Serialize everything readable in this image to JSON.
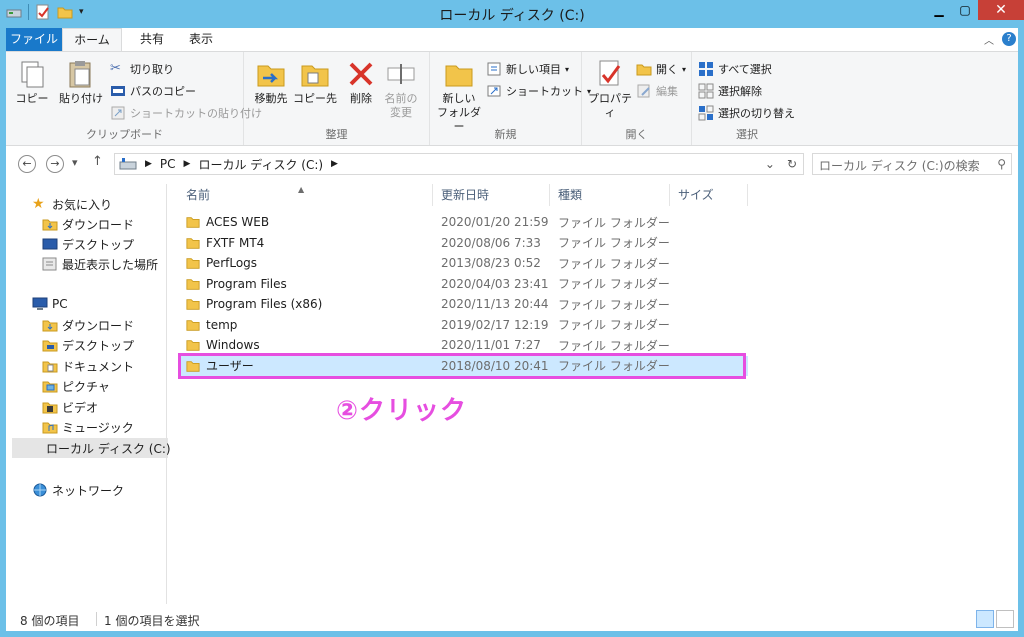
{
  "window": {
    "title": "ローカル ディスク (C:)"
  },
  "ribbon_tabs": {
    "file": "ファイル",
    "home": "ホーム",
    "share": "共有",
    "view": "表示"
  },
  "ribbon": {
    "clipboard": {
      "label": "クリップボード",
      "copy": "コピー",
      "paste": "貼り付け",
      "cut": "切り取り",
      "copy_path": "パスのコピー",
      "paste_shortcut": "ショートカットの貼り付け"
    },
    "organize": {
      "label": "整理",
      "move_to": "移動先",
      "copy_to": "コピー先",
      "delete": "削除",
      "rename_1": "名前の",
      "rename_2": "変更"
    },
    "new": {
      "label": "新規",
      "new_folder_1": "新しい",
      "new_folder_2": "フォルダー",
      "new_item": "新しい項目",
      "easy_access": "ショートカット"
    },
    "open": {
      "label": "開く",
      "properties": "プロパティ",
      "open": "開く",
      "edit": "編集"
    },
    "select": {
      "label": "選択",
      "select_all": "すべて選択",
      "select_none": "選択解除",
      "invert": "選択の切り替え"
    }
  },
  "address": {
    "crumbs": [
      "PC",
      "ローカル ディスク (C:)"
    ],
    "search_placeholder": "ローカル ディスク (C:)の検索"
  },
  "nav": {
    "favorites": "お気に入り",
    "fav_items": [
      "ダウンロード",
      "デスクトップ",
      "最近表示した場所"
    ],
    "pc": "PC",
    "pc_items": [
      "ダウンロード",
      "デスクトップ",
      "ドキュメント",
      "ピクチャ",
      "ビデオ",
      "ミュージック",
      "ローカル ディスク (C:)"
    ],
    "network": "ネットワーク"
  },
  "columns": {
    "name": "名前",
    "modified": "更新日時",
    "type": "種類",
    "size": "サイズ"
  },
  "files": [
    {
      "name": "ACES WEB",
      "modified": "2020/01/20 21:59",
      "type": "ファイル フォルダー"
    },
    {
      "name": "FXTF MT4",
      "modified": "2020/08/06 7:33",
      "type": "ファイル フォルダー"
    },
    {
      "name": "PerfLogs",
      "modified": "2013/08/23 0:52",
      "type": "ファイル フォルダー"
    },
    {
      "name": "Program Files",
      "modified": "2020/04/03 23:41",
      "type": "ファイル フォルダー"
    },
    {
      "name": "Program Files (x86)",
      "modified": "2020/11/13 20:44",
      "type": "ファイル フォルダー"
    },
    {
      "name": "temp",
      "modified": "2019/02/17 12:19",
      "type": "ファイル フォルダー"
    },
    {
      "name": "Windows",
      "modified": "2020/11/01 7:27",
      "type": "ファイル フォルダー"
    },
    {
      "name": "ユーザー",
      "modified": "2018/08/10 20:41",
      "type": "ファイル フォルダー"
    }
  ],
  "annotation": "②クリック",
  "status": {
    "items_count": "8 個の項目",
    "selected": "1 個の項目を選択"
  },
  "colors": {
    "accent": "#1979ca",
    "highlight": "#e64ee0",
    "selection": "#cce8ff",
    "titlebar": "#6cc0e8"
  }
}
